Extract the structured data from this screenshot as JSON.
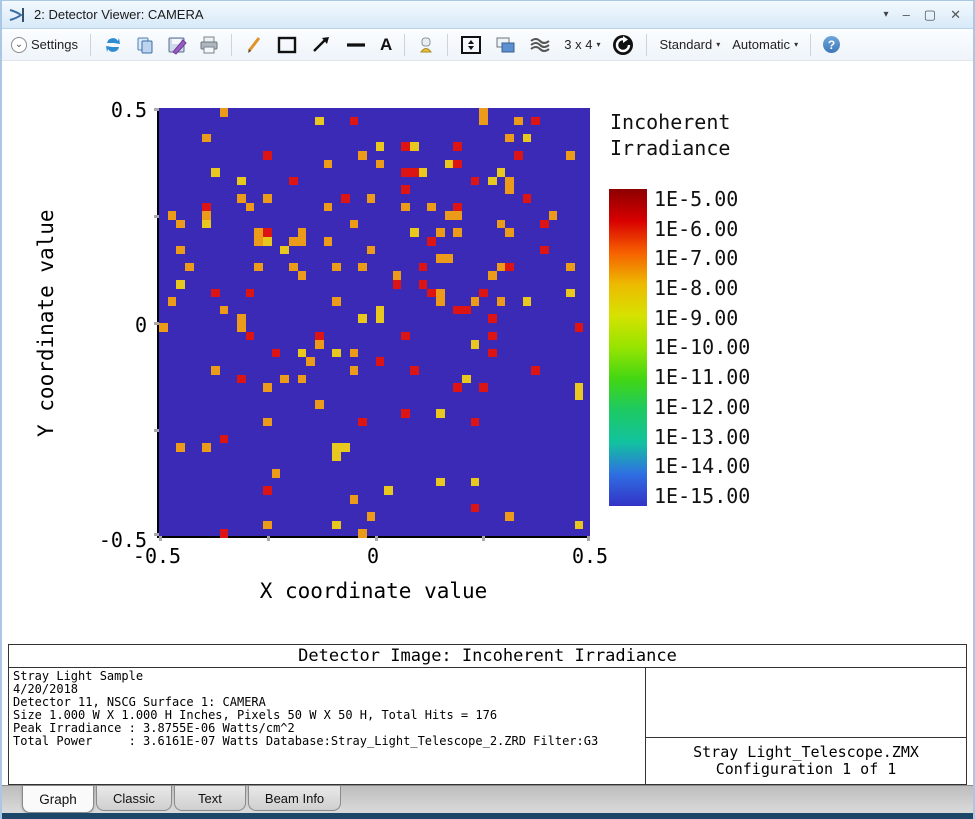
{
  "window": {
    "title": "2: Detector Viewer: CAMERA",
    "controls": {
      "menu": "▾",
      "minimize": "–",
      "maximize": "▢",
      "close": "✕"
    }
  },
  "toolbar": {
    "settings_label": "Settings",
    "grid_label": "3 x 4",
    "standard_label": "Standard",
    "automatic_label": "Automatic",
    "caret": "▾",
    "chevron": "⌄",
    "text_tool_glyph": "A",
    "help_glyph": "?"
  },
  "chart_data": {
    "type": "heatmap",
    "title": "Detector Image: Incoherent Irradiance",
    "xlabel": "X coordinate value",
    "ylabel": "Y coordinate value",
    "x_ticks": [
      "-0.5",
      "0",
      "0.5"
    ],
    "y_ticks": [
      "0.5",
      "0",
      "-0.5"
    ],
    "xlim": [
      -0.5,
      0.5
    ],
    "ylim": [
      -0.5,
      0.5
    ],
    "grid_size": 50,
    "total_hits": 176,
    "background_color": "#3a2ab6",
    "palette": {
      "r": "#dc1414",
      "o": "#ec9a1a",
      "y": "#e8c81e"
    },
    "legend": {
      "title_lines": [
        "Incoherent",
        "Irradiance"
      ],
      "labels": [
        "1E-5.00",
        "1E-6.00",
        "1E-7.00",
        "1E-8.00",
        "1E-9.00",
        "1E-10.00",
        "1E-11.00",
        "1E-12.00",
        "1E-13.00",
        "1E-14.00",
        "1E-15.00"
      ],
      "gradient": [
        "#8c0000",
        "#d80000",
        "#f66000",
        "#edba00",
        "#d6e200",
        "#96e400",
        "#42d614",
        "#1cc964",
        "#12c2a0",
        "#2f6ee2",
        "#3333c6"
      ]
    },
    "points": [
      [
        7,
        0,
        "o"
      ],
      [
        18,
        1,
        "y"
      ],
      [
        22,
        1,
        "r"
      ],
      [
        5,
        3,
        "o"
      ],
      [
        12,
        5,
        "r"
      ],
      [
        23,
        5,
        "o"
      ],
      [
        19,
        6,
        "o"
      ],
      [
        6,
        7,
        "y"
      ],
      [
        9,
        8,
        "y"
      ],
      [
        15,
        8,
        "r"
      ],
      [
        9,
        10,
        "o"
      ],
      [
        12,
        10,
        "o"
      ],
      [
        21,
        10,
        "r"
      ],
      [
        24,
        10,
        "o"
      ],
      [
        10,
        11,
        "o"
      ],
      [
        5,
        11,
        "r"
      ],
      [
        5,
        12,
        "o"
      ],
      [
        5,
        13,
        "y"
      ],
      [
        1,
        12,
        "o"
      ],
      [
        2,
        13,
        "o"
      ],
      [
        19,
        11,
        "o"
      ],
      [
        22,
        13,
        "o"
      ],
      [
        11,
        14,
        "o"
      ],
      [
        12,
        14,
        "r"
      ],
      [
        11,
        15,
        "o"
      ],
      [
        12,
        15,
        "y"
      ],
      [
        16,
        14,
        "o"
      ],
      [
        15,
        15,
        "o"
      ],
      [
        16,
        15,
        "o"
      ],
      [
        14,
        16,
        "y"
      ],
      [
        19,
        15,
        "o"
      ],
      [
        24,
        16,
        "o"
      ],
      [
        2,
        16,
        "o"
      ],
      [
        3,
        18,
        "o"
      ],
      [
        11,
        18,
        "o"
      ],
      [
        15,
        18,
        "o"
      ],
      [
        16,
        19,
        "o"
      ],
      [
        20,
        18,
        "o"
      ],
      [
        23,
        18,
        "o"
      ],
      [
        2,
        20,
        "y"
      ],
      [
        6,
        21,
        "r"
      ],
      [
        10,
        21,
        "r"
      ],
      [
        1,
        22,
        "o"
      ],
      [
        20,
        22,
        "o"
      ],
      [
        7,
        23,
        "o"
      ],
      [
        9,
        24,
        "o"
      ],
      [
        23,
        24,
        "y"
      ],
      [
        37,
        0,
        "o"
      ],
      [
        37,
        1,
        "o"
      ],
      [
        41,
        1,
        "o"
      ],
      [
        43,
        1,
        "r"
      ],
      [
        40,
        3,
        "o"
      ],
      [
        42,
        3,
        "y"
      ],
      [
        25,
        4,
        "y"
      ],
      [
        28,
        4,
        "r"
      ],
      [
        29,
        4,
        "y"
      ],
      [
        34,
        4,
        "r"
      ],
      [
        41,
        5,
        "r"
      ],
      [
        47,
        5,
        "o"
      ],
      [
        25,
        6,
        "o"
      ],
      [
        33,
        6,
        "y"
      ],
      [
        34,
        6,
        "r"
      ],
      [
        28,
        7,
        "r"
      ],
      [
        29,
        7,
        "r"
      ],
      [
        30,
        7,
        "y"
      ],
      [
        39,
        7,
        "y"
      ],
      [
        36,
        8,
        "r"
      ],
      [
        38,
        8,
        "y"
      ],
      [
        40,
        8,
        "o"
      ],
      [
        28,
        9,
        "r"
      ],
      [
        40,
        9,
        "o"
      ],
      [
        42,
        10,
        "r"
      ],
      [
        28,
        11,
        "o"
      ],
      [
        31,
        11,
        "o"
      ],
      [
        34,
        11,
        "r"
      ],
      [
        33,
        12,
        "o"
      ],
      [
        34,
        12,
        "o"
      ],
      [
        45,
        12,
        "o"
      ],
      [
        39,
        13,
        "o"
      ],
      [
        44,
        13,
        "r"
      ],
      [
        29,
        14,
        "y"
      ],
      [
        32,
        14,
        "o"
      ],
      [
        34,
        14,
        "o"
      ],
      [
        40,
        14,
        "o"
      ],
      [
        31,
        15,
        "r"
      ],
      [
        44,
        16,
        "r"
      ],
      [
        32,
        17,
        "o"
      ],
      [
        33,
        17,
        "o"
      ],
      [
        30,
        18,
        "r"
      ],
      [
        39,
        18,
        "o"
      ],
      [
        40,
        18,
        "r"
      ],
      [
        47,
        18,
        "o"
      ],
      [
        27,
        19,
        "o"
      ],
      [
        38,
        19,
        "o"
      ],
      [
        27,
        20,
        "r"
      ],
      [
        30,
        20,
        "r"
      ],
      [
        31,
        21,
        "r"
      ],
      [
        32,
        21,
        "o"
      ],
      [
        32,
        22,
        "o"
      ],
      [
        37,
        21,
        "r"
      ],
      [
        47,
        21,
        "y"
      ],
      [
        39,
        22,
        "o"
      ],
      [
        42,
        22,
        "y"
      ],
      [
        36,
        22,
        "o"
      ],
      [
        34,
        23,
        "r"
      ],
      [
        35,
        23,
        "r"
      ],
      [
        25,
        23,
        "y"
      ],
      [
        25,
        24,
        "y"
      ],
      [
        38,
        24,
        "r"
      ],
      [
        0,
        25,
        "o"
      ],
      [
        9,
        25,
        "o"
      ],
      [
        10,
        26,
        "r"
      ],
      [
        18,
        26,
        "r"
      ],
      [
        18,
        27,
        "o"
      ],
      [
        13,
        28,
        "r"
      ],
      [
        16,
        28,
        "y"
      ],
      [
        20,
        28,
        "y"
      ],
      [
        22,
        28,
        "o"
      ],
      [
        17,
        29,
        "o"
      ],
      [
        6,
        30,
        "o"
      ],
      [
        22,
        30,
        "o"
      ],
      [
        9,
        31,
        "r"
      ],
      [
        14,
        31,
        "o"
      ],
      [
        16,
        31,
        "o"
      ],
      [
        12,
        32,
        "o"
      ],
      [
        18,
        34,
        "o"
      ],
      [
        12,
        36,
        "o"
      ],
      [
        23,
        36,
        "r"
      ],
      [
        7,
        38,
        "r"
      ],
      [
        2,
        39,
        "o"
      ],
      [
        5,
        39,
        "o"
      ],
      [
        20,
        39,
        "y"
      ],
      [
        21,
        39,
        "y"
      ],
      [
        20,
        40,
        "y"
      ],
      [
        13,
        42,
        "o"
      ],
      [
        12,
        44,
        "r"
      ],
      [
        22,
        45,
        "o"
      ],
      [
        24,
        47,
        "o"
      ],
      [
        12,
        48,
        "o"
      ],
      [
        20,
        48,
        "y"
      ],
      [
        7,
        49,
        "r"
      ],
      [
        23,
        49,
        "o"
      ],
      [
        48,
        25,
        "r"
      ],
      [
        28,
        26,
        "r"
      ],
      [
        36,
        27,
        "y"
      ],
      [
        38,
        26,
        "r"
      ],
      [
        38,
        28,
        "r"
      ],
      [
        25,
        29,
        "r"
      ],
      [
        29,
        30,
        "r"
      ],
      [
        43,
        30,
        "r"
      ],
      [
        35,
        31,
        "y"
      ],
      [
        34,
        32,
        "r"
      ],
      [
        37,
        32,
        "r"
      ],
      [
        48,
        32,
        "y"
      ],
      [
        48,
        33,
        "y"
      ],
      [
        28,
        35,
        "r"
      ],
      [
        32,
        35,
        "y"
      ],
      [
        36,
        36,
        "r"
      ],
      [
        32,
        43,
        "y"
      ],
      [
        36,
        43,
        "y"
      ],
      [
        26,
        44,
        "y"
      ],
      [
        36,
        46,
        "r"
      ],
      [
        40,
        47,
        "o"
      ],
      [
        48,
        48,
        "y"
      ]
    ]
  },
  "info_panel": {
    "header": "Detector Image: Incoherent Irradiance",
    "lines": [
      "Stray Light Sample",
      "4/20/2018",
      "Detector 11, NSCG Surface 1: CAMERA",
      "Size 1.000 W X 1.000 H Inches, Pixels 50 W X 50 H, Total Hits = 176",
      "Peak Irradiance : 3.8755E-06 Watts/cm^2",
      "Total Power     : 3.6161E-07 Watts Database:Stray_Light_Telescope_2.ZRD Filter:G3"
    ],
    "file_label": "Stray Light_Telescope.ZMX",
    "config_label": "Configuration 1 of 1"
  },
  "tabs": [
    {
      "label": "Graph",
      "active": true
    },
    {
      "label": "Classic",
      "active": false
    },
    {
      "label": "Text",
      "active": false
    },
    {
      "label": "Beam Info",
      "active": false
    }
  ]
}
